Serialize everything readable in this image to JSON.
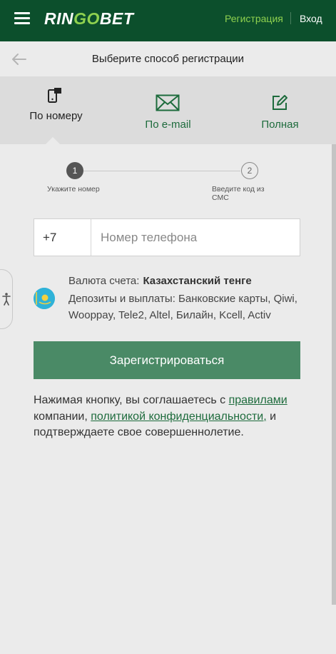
{
  "header": {
    "logo_prefix": "RIN",
    "logo_accent": "GO",
    "logo_suffix": "BET",
    "register_link": "Регистрация",
    "login_link": "Вход",
    "bg_color": "#0c4f2c",
    "accent_color": "#8fd14f"
  },
  "subheader": {
    "title": "Выберите способ регистрации"
  },
  "tabs": [
    {
      "label": "По номеру",
      "icon": "phone-icon",
      "active": true
    },
    {
      "label": "По e-mail",
      "icon": "envelope-icon",
      "active": false
    },
    {
      "label": "Полная",
      "icon": "edit-icon",
      "active": false
    }
  ],
  "steps": [
    {
      "number": "1",
      "label": "Укажите номер"
    },
    {
      "number": "2",
      "label": "Введите код из СМС"
    }
  ],
  "phone": {
    "country_code": "+7",
    "placeholder": "Номер телефона"
  },
  "currency": {
    "label": "Валюта счета:",
    "value": "Казахстанский тенге",
    "methods": "Депозиты и выплаты: Банковские карты, Qiwi, Wooppay, Tele2, Altel, Билайн, Kcell, Activ"
  },
  "register_button": "Зарегистрироваться",
  "agreement": {
    "text_1": "Нажимая кнопку, вы соглашаетесь с ",
    "rules_link": "правилами",
    "text_2": " компании, ",
    "policy_link": "политикой конфиденциальности,",
    "text_3": " и подтверждаете свое совершеннолетие."
  }
}
